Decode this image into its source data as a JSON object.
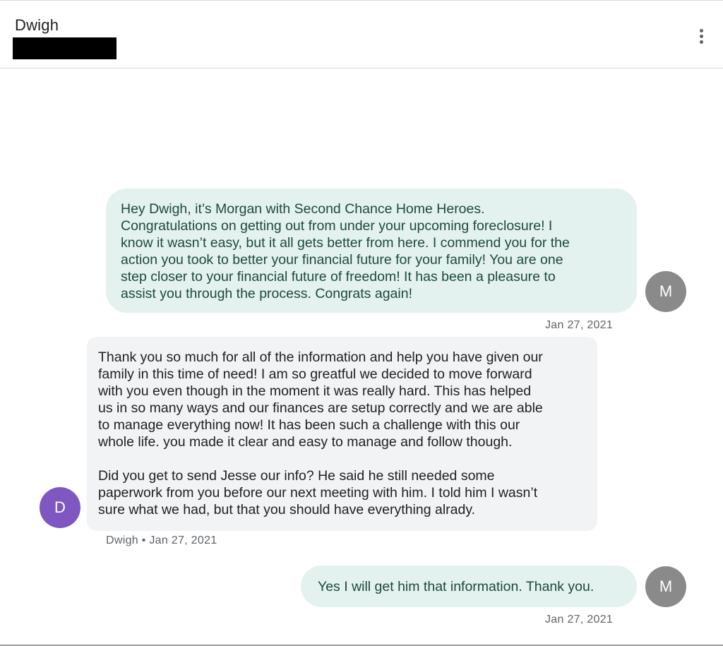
{
  "header": {
    "contact_name": "Dwigh",
    "more_options_icon": "more-vertical-icon"
  },
  "messages": [
    {
      "direction": "outgoing",
      "text": "Hey Dwigh, it’s Morgan with Second Chance Home Heroes.\nCongratulations on getting out from under your upcoming foreclosure! I\nknow it wasn’t easy, but it all gets better from here. I commend you for the\naction you took to better your financial future for your family! You are one\nstep closer to your financial future of freedom! It has been a pleasure to\nassist you through the process. Congrats again!",
      "avatar_initial": "M",
      "meta": "Jan 27, 2021"
    },
    {
      "direction": "incoming",
      "text": "Thank you so much for all of the information and help you have given our\nfamily in this time of need! I am so greatful we decided to move forward\nwith you even though in the moment it was really hard. This has helped\nus in so many ways and our finances are setup correctly  and we are able\nto manage everything now! It has been such a challenge with this our\nwhole life. you made it clear and easy to manage and follow though.\n\nDid you get to send Jesse our info? He said he still needed some\npaperwork from you before our next meeting with him. I told him I wasn’t\nsure what we had, but that you should have everything alrady.",
      "avatar_initial": "D",
      "meta": "Dwigh • Jan 27, 2021"
    },
    {
      "direction": "outgoing",
      "text": "Yes I will get him that information. Thank you.",
      "avatar_initial": "M",
      "meta": "Jan 27, 2021"
    }
  ],
  "colors": {
    "outgoing_bubble": "#e3f1ef",
    "outgoing_text": "#1d4a3e",
    "incoming_bubble": "#f1f3f4",
    "my_avatar": "#8a8a8a",
    "contact_avatar": "#7e57c2"
  }
}
